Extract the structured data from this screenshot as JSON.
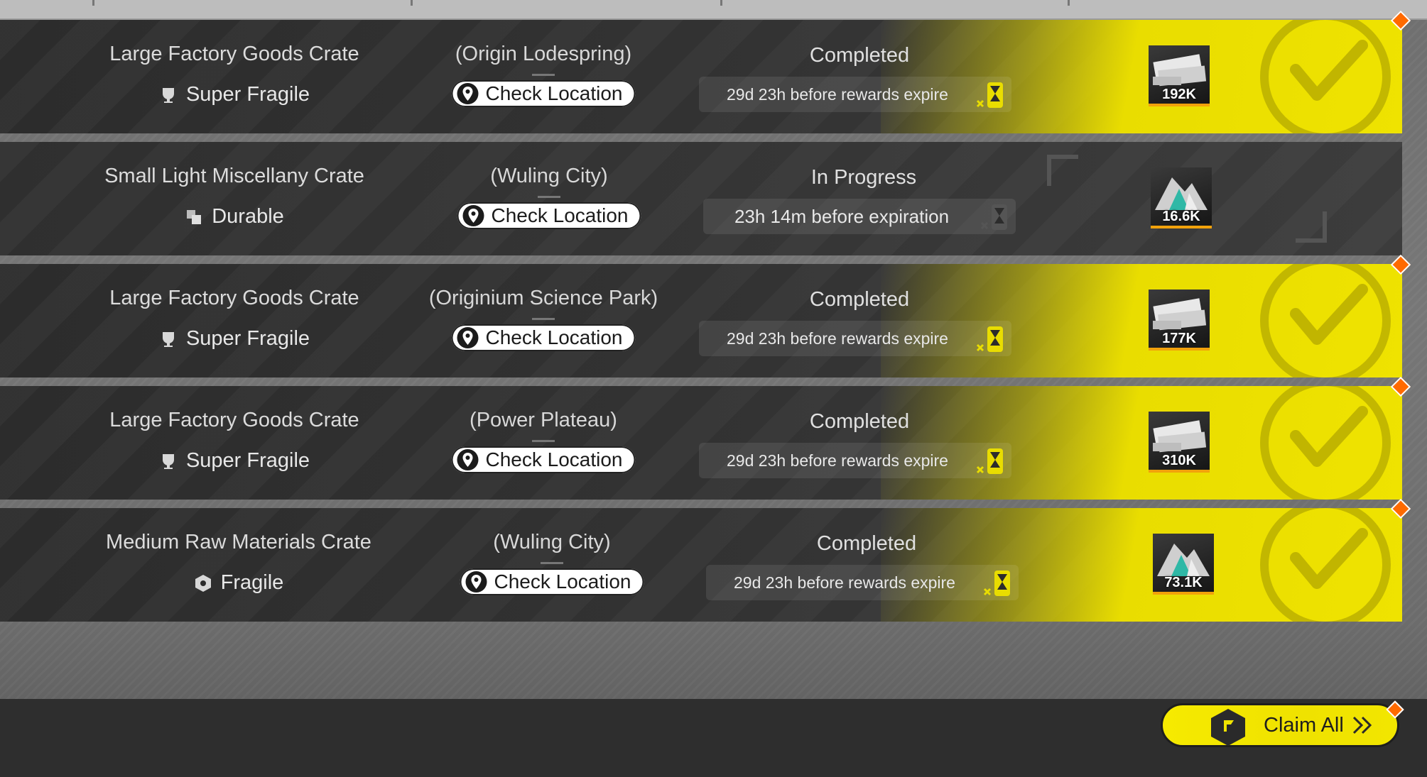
{
  "colors": {
    "accent_yellow": "#e9dd00",
    "diamond_orange": "#ff6a00",
    "row_dark": "#2c2c2c",
    "reward_underline": "#f2a20b"
  },
  "orders": [
    {
      "crate": "Large Factory Goods Crate",
      "fragility": "Super Fragile",
      "fragility_icon": "cup-icon",
      "location": "(Origin Lodespring)",
      "check_label": "Check Location",
      "status": "Completed",
      "timer": "29d 23h before rewards expire",
      "reward": "192K",
      "completed": true
    },
    {
      "crate": "Small Light Miscellany Crate",
      "fragility": "Durable",
      "fragility_icon": "layers-icon",
      "location": "(Wuling City)",
      "check_label": "Check Location",
      "status": "In Progress",
      "timer": "23h 14m before expiration",
      "reward": "16.6K",
      "completed": false
    },
    {
      "crate": "Large Factory Goods Crate",
      "fragility": "Super Fragile",
      "fragility_icon": "cup-icon",
      "location": "(Originium Science Park)",
      "check_label": "Check Location",
      "status": "Completed",
      "timer": "29d 23h before rewards expire",
      "reward": "177K",
      "completed": true
    },
    {
      "crate": "Large Factory Goods Crate",
      "fragility": "Super Fragile",
      "fragility_icon": "cup-icon",
      "location": "(Power Plateau)",
      "check_label": "Check Location",
      "status": "Completed",
      "timer": "29d 23h before rewards expire",
      "reward": "310K",
      "completed": true
    },
    {
      "crate": "Medium Raw Materials Crate",
      "fragility": "Fragile",
      "fragility_icon": "hexagon-icon",
      "location": "(Wuling City)",
      "check_label": "Check Location",
      "status": "Completed",
      "timer": "29d 23h before rewards expire",
      "reward": "73.1K",
      "completed": true
    }
  ],
  "footer": {
    "claim_all_label": "Claim All"
  }
}
